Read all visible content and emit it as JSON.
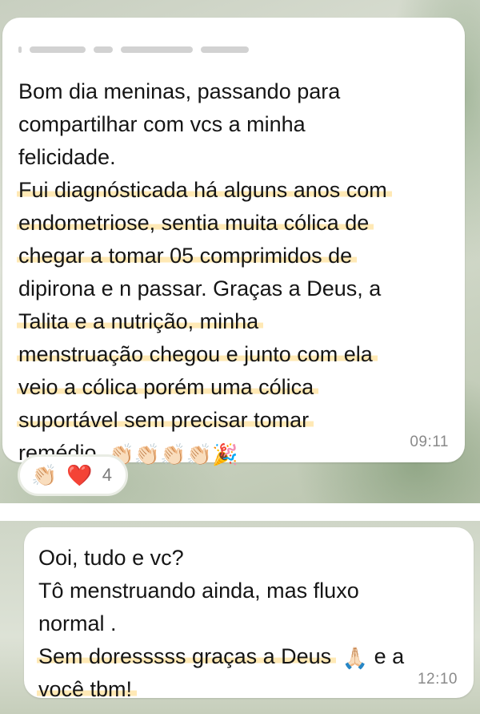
{
  "message_1": {
    "lines": [
      {
        "text": "Bom dia meninas, passando para",
        "highlight": false
      },
      {
        "text": "compartilhar com vcs a minha",
        "highlight": false
      },
      {
        "text": "felicidade.",
        "highlight": false
      },
      {
        "text": "Fui diagnósticada há alguns anos com",
        "highlight": true
      },
      {
        "text": "endometriose, sentia muita cólica de",
        "highlight": true
      },
      {
        "text": "chegar a tomar 05 comprimidos de",
        "highlight": true
      },
      {
        "text": "dipirona e n passar. Graças a Deus, a",
        "highlight": false
      },
      {
        "text": "Talita e a nutrição, minha",
        "highlight": true
      },
      {
        "text": "menstruação chegou e junto com ela",
        "highlight": true
      },
      {
        "text": "veio a cólica porém uma cólica",
        "highlight": true
      },
      {
        "text": "suportável sem precisar tomar",
        "highlight": true
      },
      {
        "text": "remédio.",
        "highlight": false
      }
    ],
    "trailing_emojis": "👏🏻👏🏻👏🏻👏🏻🎉",
    "time": "09:11",
    "reactions": {
      "emoji_1": "👏🏻",
      "emoji_2": "❤️",
      "count": "4"
    }
  },
  "message_2": {
    "lines": [
      {
        "text": "Ooi, tudo e vc?",
        "highlight": false
      },
      {
        "text": "Tô menstruando ainda, mas fluxo",
        "highlight": false
      },
      {
        "text": "normal .",
        "highlight": false
      },
      {
        "text": "Sem doresssss graças a Deus",
        "highlight": true
      },
      {
        "text": "você tbm!",
        "highlight": true
      }
    ],
    "inline_emoji": "🙏🏻",
    "line_4_suffix": "e a",
    "time": "12:10"
  },
  "colors": {
    "bubble": "#ffffff",
    "highlight": "#ffd778",
    "timestamp": "#8a8a8a"
  }
}
